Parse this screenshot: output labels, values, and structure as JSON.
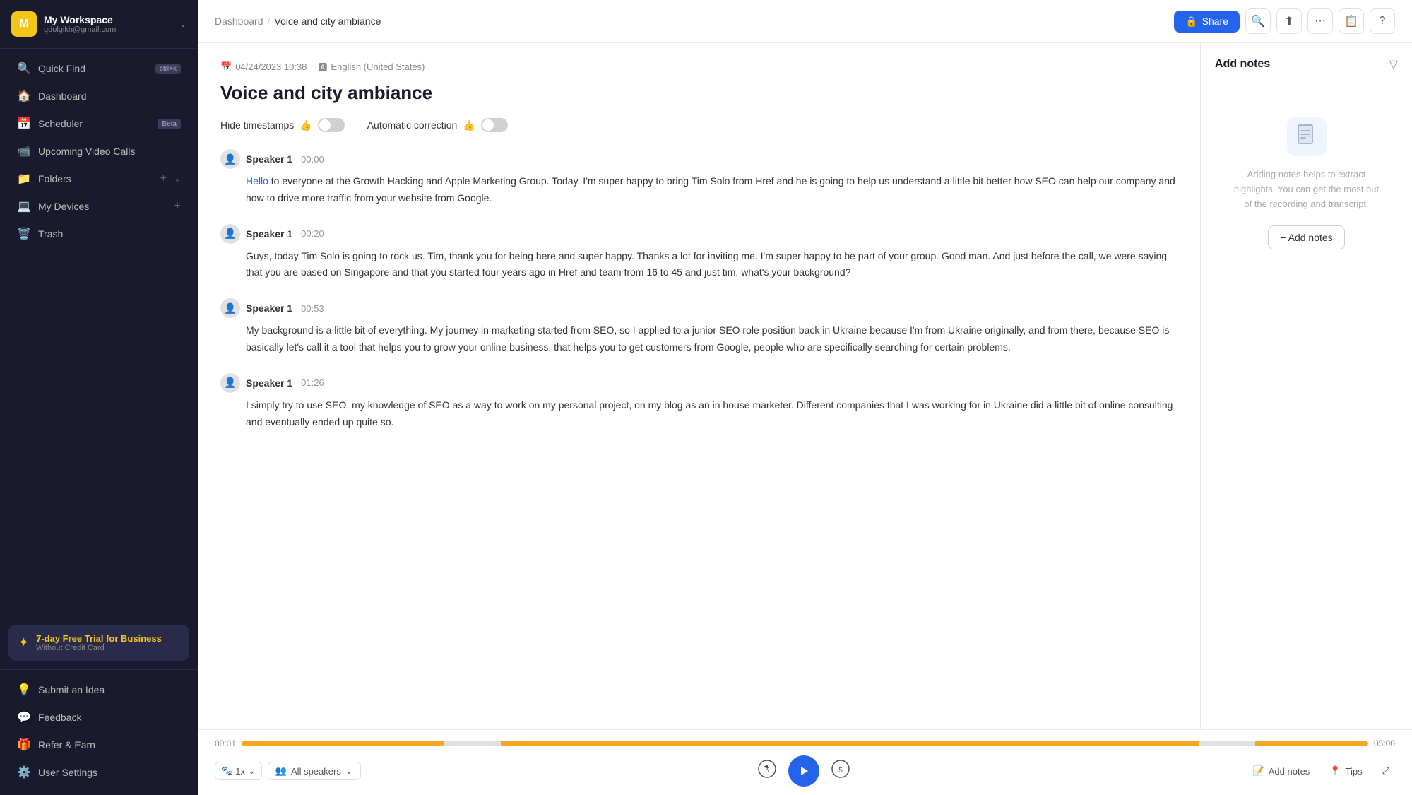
{
  "sidebar": {
    "workspace_name": "My Workspace",
    "workspace_email": "gdolgikh@gmail.com",
    "avatar_letter": "M",
    "nav_items": [
      {
        "id": "quick-find",
        "label": "Quick Find",
        "shortcut": "ctrl+k",
        "icon": "🔍"
      },
      {
        "id": "dashboard",
        "label": "Dashboard",
        "icon": "🏠"
      },
      {
        "id": "scheduler",
        "label": "Scheduler",
        "icon": "📅",
        "badge": "Beta"
      },
      {
        "id": "upcoming-video",
        "label": "Upcoming Video Calls",
        "icon": "📹"
      },
      {
        "id": "folders",
        "label": "Folders",
        "icon": "📁",
        "has_plus": true,
        "has_chevron": true
      },
      {
        "id": "my-devices",
        "label": "My Devices",
        "icon": "💻",
        "has_plus": true
      },
      {
        "id": "trash",
        "label": "Trash",
        "icon": "🗑️"
      }
    ],
    "trial": {
      "main": "7-day Free Trial for Business",
      "sub": "Without Credit Card"
    },
    "bottom_items": [
      {
        "id": "submit-idea",
        "label": "Submit an Idea",
        "icon": "💡"
      },
      {
        "id": "feedback",
        "label": "Feedback",
        "icon": "💬"
      },
      {
        "id": "refer-earn",
        "label": "Refer & Earn",
        "icon": "🎁"
      },
      {
        "id": "user-settings",
        "label": "User Settings",
        "icon": "⚙️"
      }
    ]
  },
  "topbar": {
    "breadcrumb_parent": "Dashboard",
    "breadcrumb_sep": "/",
    "breadcrumb_current": "Voice and city ambiance",
    "share_label": "Share",
    "share_icon": "🔒"
  },
  "recording": {
    "date": "04/24/2023",
    "time": "10:38",
    "language": "English (United States)",
    "title": "Voice and city ambiance",
    "hide_timestamps_label": "Hide timestamps",
    "hide_timestamps_emoji": "👍",
    "hide_timestamps_on": false,
    "automatic_correction_label": "Automatic correction",
    "automatic_correction_emoji": "👍",
    "automatic_correction_on": false
  },
  "transcript": {
    "segments": [
      {
        "speaker": "Speaker 1",
        "time": "00:00",
        "text_parts": [
          {
            "type": "link",
            "text": "Hello"
          },
          {
            "type": "normal",
            "text": " to everyone at the Growth Hacking and Apple Marketing Group. Today, I'm super happy to bring Tim Solo from Href and he is going to help us understand a little bit better how SEO can help our company and how to drive more traffic from your website from Google."
          }
        ]
      },
      {
        "speaker": "Speaker 1",
        "time": "00:20",
        "text_parts": [
          {
            "type": "normal",
            "text": "Guys, today Tim Solo is going to rock us. Tim, thank you for being here and super happy. Thanks a lot for inviting me. I'm super happy to be part of your group. Good man. And just before the call, we were saying that you are based on Singapore and that you started four years ago in Href and team from 16 to 45 and just tim, what's your background?"
          }
        ]
      },
      {
        "speaker": "Speaker 1",
        "time": "00:53",
        "text_parts": [
          {
            "type": "normal",
            "text": "My background is a little bit of everything. My journey in marketing started from SEO, so I applied to a junior SEO role position back in Ukraine because I'm from Ukraine originally, and from there, because SEO is basically let's call it a tool that helps you to grow your online business, that helps you to get customers from Google, people who are specifically searching for certain problems."
          }
        ]
      },
      {
        "speaker": "Speaker 1",
        "time": "01:26",
        "text_parts": [
          {
            "type": "normal",
            "text": "I simply try to use SEO, my knowledge of SEO as a way to work on my personal project, on my blog as an in house marketer. Different companies that I was working for in Ukraine did a little bit of online consulting and eventually ended up quite so."
          }
        ]
      }
    ]
  },
  "notes_panel": {
    "title": "Add notes",
    "empty_text": "Adding notes helps to extract highlights. You can get the most out of the recording and transcript.",
    "add_notes_label": "+ Add notes"
  },
  "audio_player": {
    "current_time": "00:01",
    "total_time": "05:00",
    "speed": "1x",
    "speaker_filter": "All speakers",
    "add_notes_label": "Add notes",
    "tips_label": "Tips"
  }
}
